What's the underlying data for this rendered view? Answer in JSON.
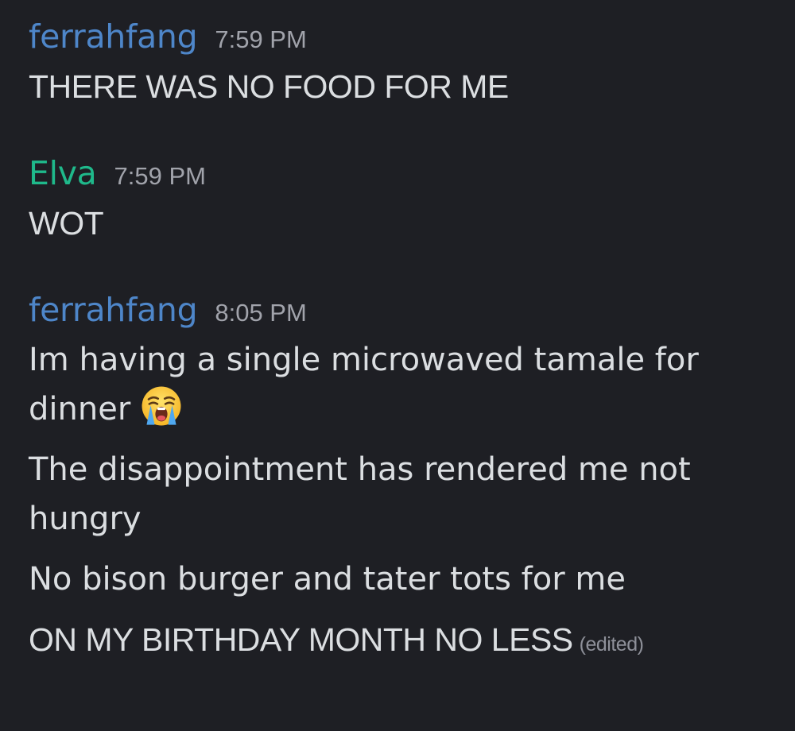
{
  "colors": {
    "background": "#1e1f24",
    "ferrahfang": "#4e86c9",
    "elva": "#1fb98b",
    "text": "#dbdee1",
    "timestamp": "#a1a3ab"
  },
  "messages": [
    {
      "author": "ferrahfang",
      "time": "7:59 PM",
      "lines": [
        "THERE WAS NO FOOD FOR ME"
      ]
    },
    {
      "author": "Elva",
      "time": "7:59 PM",
      "lines": [
        "WOT"
      ]
    },
    {
      "author": "ferrahfang",
      "time": "8:05 PM",
      "lines": [
        "Im having a single microwaved tamale for dinner",
        "The disappointment has rendered me not hungry",
        "No bison burger and tater tots for me",
        "ON MY BIRTHDAY MONTH NO LESS"
      ],
      "emoji": "loudly-crying-face-icon",
      "edited_label": "(edited)"
    }
  ]
}
